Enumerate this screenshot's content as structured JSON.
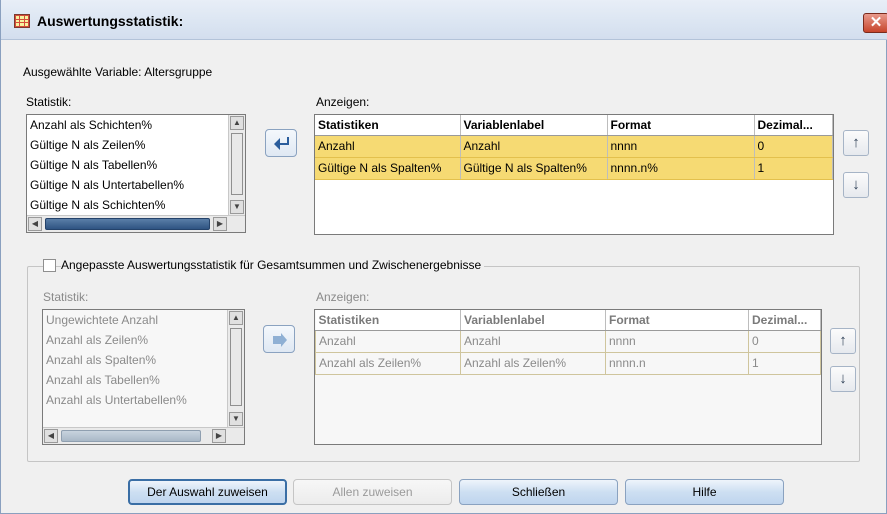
{
  "window": {
    "title": "Auswertungsstatistik:",
    "close_glyph": "✕"
  },
  "selected_variable": "Ausgewählte Variable: Altersgruppe",
  "top": {
    "statistik_label": "Statistik:",
    "anzeigen_label": "Anzeigen:",
    "list_items": [
      "Anzahl als Schichten%",
      "Gültige N als Zeilen%",
      "Gültige N als Tabellen%",
      "Gültige N als Untertabellen%",
      "Gültige N als Schichten%"
    ],
    "columns": [
      "Statistiken",
      "Variablenlabel",
      "Format",
      "Dezimal..."
    ],
    "rows": [
      [
        "Anzahl",
        "Anzahl",
        "nnnn",
        "0"
      ],
      [
        "Gültige N als Spalten%",
        "Gültige N als Spalten%",
        "nnnn.n%",
        "1"
      ]
    ]
  },
  "custom": {
    "checkbox_label": "Angepasste Auswertungsstatistik für Gesamtsummen und Zwischenergebnisse",
    "checked": false,
    "statistik_label": "Statistik:",
    "anzeigen_label": "Anzeigen:",
    "list_items": [
      "Ungewichtete Anzahl",
      "Anzahl als Zeilen%",
      "Anzahl als Spalten%",
      "Anzahl als Tabellen%",
      "Anzahl als Untertabellen%"
    ],
    "columns": [
      "Statistiken",
      "Variablenlabel",
      "Format",
      "Dezimal..."
    ],
    "rows": [
      [
        "Anzahl",
        "Anzahl",
        "nnnn",
        "0"
      ],
      [
        "Anzahl als Zeilen%",
        "Anzahl als Zeilen%",
        "nnnn.n",
        "1"
      ]
    ]
  },
  "buttons": {
    "apply_selection": "Der Auswahl zuweisen",
    "apply_all": "Allen zuweisen",
    "close": "Schließen",
    "help": "Hilfe"
  },
  "icons": {
    "move_left": "arrow-left-icon",
    "move_right": "arrow-right-icon",
    "up": "arrow-up-icon",
    "down": "arrow-down-icon"
  }
}
